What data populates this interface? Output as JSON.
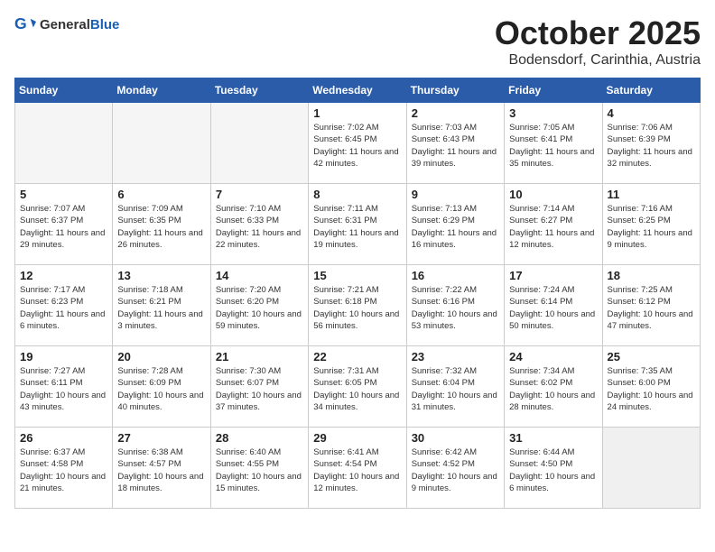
{
  "header": {
    "logo_general": "General",
    "logo_blue": "Blue",
    "month": "October 2025",
    "location": "Bodensdorf, Carinthia, Austria"
  },
  "weekdays": [
    "Sunday",
    "Monday",
    "Tuesday",
    "Wednesday",
    "Thursday",
    "Friday",
    "Saturday"
  ],
  "weeks": [
    [
      {
        "day": "",
        "empty": true
      },
      {
        "day": "",
        "empty": true
      },
      {
        "day": "",
        "empty": true
      },
      {
        "day": "1",
        "sunrise": "7:02 AM",
        "sunset": "6:45 PM",
        "daylight": "11 hours and 42 minutes."
      },
      {
        "day": "2",
        "sunrise": "7:03 AM",
        "sunset": "6:43 PM",
        "daylight": "11 hours and 39 minutes."
      },
      {
        "day": "3",
        "sunrise": "7:05 AM",
        "sunset": "6:41 PM",
        "daylight": "11 hours and 35 minutes."
      },
      {
        "day": "4",
        "sunrise": "7:06 AM",
        "sunset": "6:39 PM",
        "daylight": "11 hours and 32 minutes."
      }
    ],
    [
      {
        "day": "5",
        "sunrise": "7:07 AM",
        "sunset": "6:37 PM",
        "daylight": "11 hours and 29 minutes."
      },
      {
        "day": "6",
        "sunrise": "7:09 AM",
        "sunset": "6:35 PM",
        "daylight": "11 hours and 26 minutes."
      },
      {
        "day": "7",
        "sunrise": "7:10 AM",
        "sunset": "6:33 PM",
        "daylight": "11 hours and 22 minutes."
      },
      {
        "day": "8",
        "sunrise": "7:11 AM",
        "sunset": "6:31 PM",
        "daylight": "11 hours and 19 minutes."
      },
      {
        "day": "9",
        "sunrise": "7:13 AM",
        "sunset": "6:29 PM",
        "daylight": "11 hours and 16 minutes."
      },
      {
        "day": "10",
        "sunrise": "7:14 AM",
        "sunset": "6:27 PM",
        "daylight": "11 hours and 12 minutes."
      },
      {
        "day": "11",
        "sunrise": "7:16 AM",
        "sunset": "6:25 PM",
        "daylight": "11 hours and 9 minutes."
      }
    ],
    [
      {
        "day": "12",
        "sunrise": "7:17 AM",
        "sunset": "6:23 PM",
        "daylight": "11 hours and 6 minutes."
      },
      {
        "day": "13",
        "sunrise": "7:18 AM",
        "sunset": "6:21 PM",
        "daylight": "11 hours and 3 minutes."
      },
      {
        "day": "14",
        "sunrise": "7:20 AM",
        "sunset": "6:20 PM",
        "daylight": "10 hours and 59 minutes."
      },
      {
        "day": "15",
        "sunrise": "7:21 AM",
        "sunset": "6:18 PM",
        "daylight": "10 hours and 56 minutes."
      },
      {
        "day": "16",
        "sunrise": "7:22 AM",
        "sunset": "6:16 PM",
        "daylight": "10 hours and 53 minutes."
      },
      {
        "day": "17",
        "sunrise": "7:24 AM",
        "sunset": "6:14 PM",
        "daylight": "10 hours and 50 minutes."
      },
      {
        "day": "18",
        "sunrise": "7:25 AM",
        "sunset": "6:12 PM",
        "daylight": "10 hours and 47 minutes."
      }
    ],
    [
      {
        "day": "19",
        "sunrise": "7:27 AM",
        "sunset": "6:11 PM",
        "daylight": "10 hours and 43 minutes."
      },
      {
        "day": "20",
        "sunrise": "7:28 AM",
        "sunset": "6:09 PM",
        "daylight": "10 hours and 40 minutes."
      },
      {
        "day": "21",
        "sunrise": "7:30 AM",
        "sunset": "6:07 PM",
        "daylight": "10 hours and 37 minutes."
      },
      {
        "day": "22",
        "sunrise": "7:31 AM",
        "sunset": "6:05 PM",
        "daylight": "10 hours and 34 minutes."
      },
      {
        "day": "23",
        "sunrise": "7:32 AM",
        "sunset": "6:04 PM",
        "daylight": "10 hours and 31 minutes."
      },
      {
        "day": "24",
        "sunrise": "7:34 AM",
        "sunset": "6:02 PM",
        "daylight": "10 hours and 28 minutes."
      },
      {
        "day": "25",
        "sunrise": "7:35 AM",
        "sunset": "6:00 PM",
        "daylight": "10 hours and 24 minutes."
      }
    ],
    [
      {
        "day": "26",
        "sunrise": "6:37 AM",
        "sunset": "4:58 PM",
        "daylight": "10 hours and 21 minutes."
      },
      {
        "day": "27",
        "sunrise": "6:38 AM",
        "sunset": "4:57 PM",
        "daylight": "10 hours and 18 minutes."
      },
      {
        "day": "28",
        "sunrise": "6:40 AM",
        "sunset": "4:55 PM",
        "daylight": "10 hours and 15 minutes."
      },
      {
        "day": "29",
        "sunrise": "6:41 AM",
        "sunset": "4:54 PM",
        "daylight": "10 hours and 12 minutes."
      },
      {
        "day": "30",
        "sunrise": "6:42 AM",
        "sunset": "4:52 PM",
        "daylight": "10 hours and 9 minutes."
      },
      {
        "day": "31",
        "sunrise": "6:44 AM",
        "sunset": "4:50 PM",
        "daylight": "10 hours and 6 minutes."
      },
      {
        "day": "",
        "empty": true,
        "shaded": true
      }
    ]
  ]
}
